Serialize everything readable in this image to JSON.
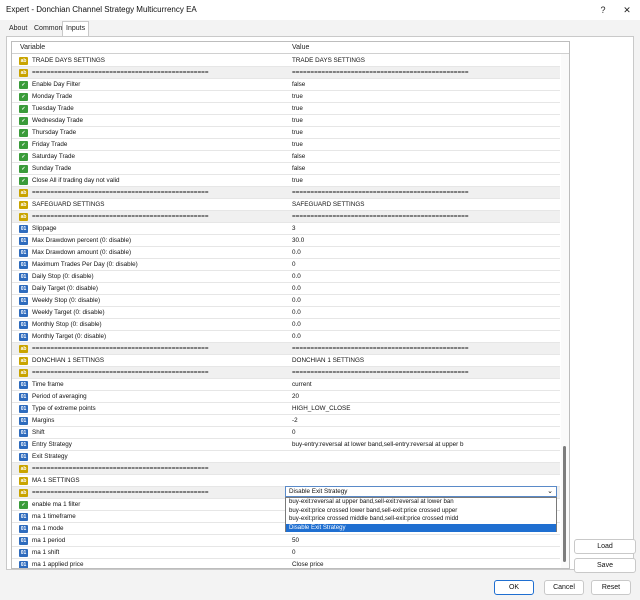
{
  "window": {
    "title": "Expert - Donchian Channel Strategy Multicurrency EA",
    "help": "?",
    "close": "✕"
  },
  "tabs": [
    "About",
    "Common",
    "Inputs"
  ],
  "header": {
    "variable": "Variable",
    "value": "Value"
  },
  "rows": [
    {
      "icon": "ab",
      "name": "TRADE DAYS SETTINGS",
      "value": "TRADE DAYS SETTINGS"
    },
    {
      "icon": "ab",
      "name": "================================================",
      "value": "================================================",
      "sep": true
    },
    {
      "icon": "bool",
      "name": "Enable Day Filter",
      "value": "false"
    },
    {
      "icon": "bool",
      "name": "Monday Trade",
      "value": "true"
    },
    {
      "icon": "bool",
      "name": "Tuesday Trade",
      "value": "true"
    },
    {
      "icon": "bool",
      "name": "Wednesday Trade",
      "value": "true"
    },
    {
      "icon": "bool",
      "name": "Thursday Trade",
      "value": "true"
    },
    {
      "icon": "bool",
      "name": "Friday Trade",
      "value": "true"
    },
    {
      "icon": "bool",
      "name": "Saturday Trade",
      "value": "false"
    },
    {
      "icon": "bool",
      "name": "Sunday Trade",
      "value": "false"
    },
    {
      "icon": "bool",
      "name": "Close All if trading day not valid",
      "value": "true"
    },
    {
      "icon": "ab",
      "name": "================================================",
      "value": "================================================",
      "sep": true
    },
    {
      "icon": "ab",
      "name": "SAFEGUARD SETTINGS",
      "value": "SAFEGUARD SETTINGS"
    },
    {
      "icon": "ab",
      "name": "================================================",
      "value": "================================================",
      "sep": true
    },
    {
      "icon": "num",
      "name": "Slippage",
      "value": "3"
    },
    {
      "icon": "num",
      "name": "Max Drawdown percent (0: disable)",
      "value": "30.0"
    },
    {
      "icon": "num",
      "name": "Max Drawdown amount (0: disable)",
      "value": "0.0"
    },
    {
      "icon": "num",
      "name": "Maximum Trades Per Day (0: disable)",
      "value": "0"
    },
    {
      "icon": "num",
      "name": "Daily Stop (0: disable)",
      "value": "0.0"
    },
    {
      "icon": "num",
      "name": "Daily Target (0: disable)",
      "value": "0.0"
    },
    {
      "icon": "num",
      "name": "Weekly Stop (0: disable)",
      "value": "0.0"
    },
    {
      "icon": "num",
      "name": "Weekly Target (0: disable)",
      "value": "0.0"
    },
    {
      "icon": "num",
      "name": "Monthly Stop (0: disable)",
      "value": "0.0"
    },
    {
      "icon": "num",
      "name": "Monthly Target (0: disable)",
      "value": "0.0"
    },
    {
      "icon": "ab",
      "name": "================================================",
      "value": "================================================",
      "sep": true
    },
    {
      "icon": "ab",
      "name": "DONCHIAN 1 SETTINGS",
      "value": "DONCHIAN 1 SETTINGS"
    },
    {
      "icon": "ab",
      "name": "================================================",
      "value": "================================================",
      "sep": true
    },
    {
      "icon": "enum",
      "name": "Time frame",
      "value": "current"
    },
    {
      "icon": "num",
      "name": "Period of averaging",
      "value": "20"
    },
    {
      "icon": "enum",
      "name": "Type of extreme points",
      "value": "HIGH_LOW_CLOSE"
    },
    {
      "icon": "num",
      "name": "Margins",
      "value": "-2"
    },
    {
      "icon": "num",
      "name": "Shift",
      "value": "0"
    },
    {
      "icon": "enum",
      "name": "Entry Strategy",
      "value": "buy-entry:reversal at lower band,sell-entry:reversal at upper b"
    },
    {
      "icon": "enum",
      "name": "Exit Strategy",
      "value": ""
    },
    {
      "icon": "ab",
      "name": "================================================",
      "value": "",
      "sep": true
    },
    {
      "icon": "ab",
      "name": "MA 1 SETTINGS",
      "value": ""
    },
    {
      "icon": "ab",
      "name": "================================================",
      "value": "",
      "sep": true
    },
    {
      "icon": "bool",
      "name": "enable ma 1 filter",
      "value": "false"
    },
    {
      "icon": "enum",
      "name": "ma 1 timeframe",
      "value": "4 Hours"
    },
    {
      "icon": "enum",
      "name": "ma 1 mode",
      "value": "Simple"
    },
    {
      "icon": "num",
      "name": "ma 1 period",
      "value": "50"
    },
    {
      "icon": "num",
      "name": "ma 1 shift",
      "value": "0"
    },
    {
      "icon": "enum",
      "name": "ma 1 applied price",
      "value": "Close price"
    }
  ],
  "exit_combo": {
    "selected": "Disable Exit Strategy",
    "options": [
      "buy-exit:reversal at upper band,sell-exit:reversal at lower ban",
      "buy-exit:price crossed lower band,sell-exit:price crossed upper",
      "buy-exit:price crossed middle band,sell-exit:price crossed midd",
      "Disable Exit Strategy"
    ]
  },
  "icon_glyphs": {
    "ab": "ab",
    "num": "01",
    "bool": "✓",
    "enum": "01"
  },
  "buttons": {
    "load": "Load",
    "save": "Save",
    "ok": "OK",
    "cancel": "Cancel",
    "reset": "Reset"
  }
}
